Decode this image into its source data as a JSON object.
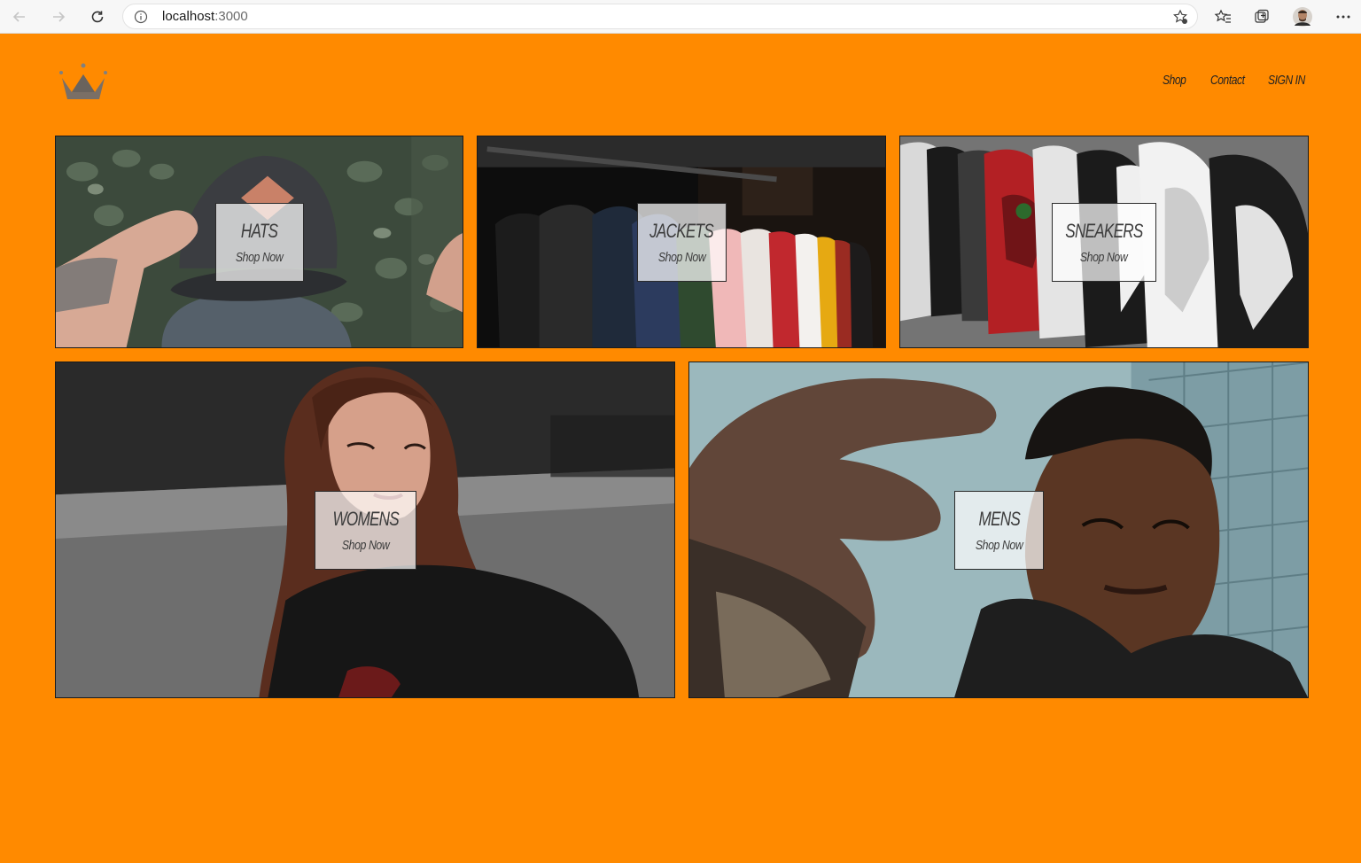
{
  "browser": {
    "url_host": "localhost",
    "url_port": ":3000"
  },
  "header": {
    "logo_icon": "crown-icon",
    "nav": [
      {
        "label": "Shop"
      },
      {
        "label": "Contact"
      },
      {
        "label": "SIGN IN"
      }
    ]
  },
  "directory": {
    "items": [
      {
        "title": "HATS",
        "subtitle": "Shop Now"
      },
      {
        "title": "JACKETS",
        "subtitle": "Shop Now"
      },
      {
        "title": "SNEAKERS",
        "subtitle": "Shop Now"
      },
      {
        "title": "WOMENS",
        "subtitle": "Shop Now"
      },
      {
        "title": "MENS",
        "subtitle": "Shop Now"
      }
    ]
  },
  "colors": {
    "page_bg": "#ff8a00",
    "chrome_bg": "#f7f7f7"
  }
}
